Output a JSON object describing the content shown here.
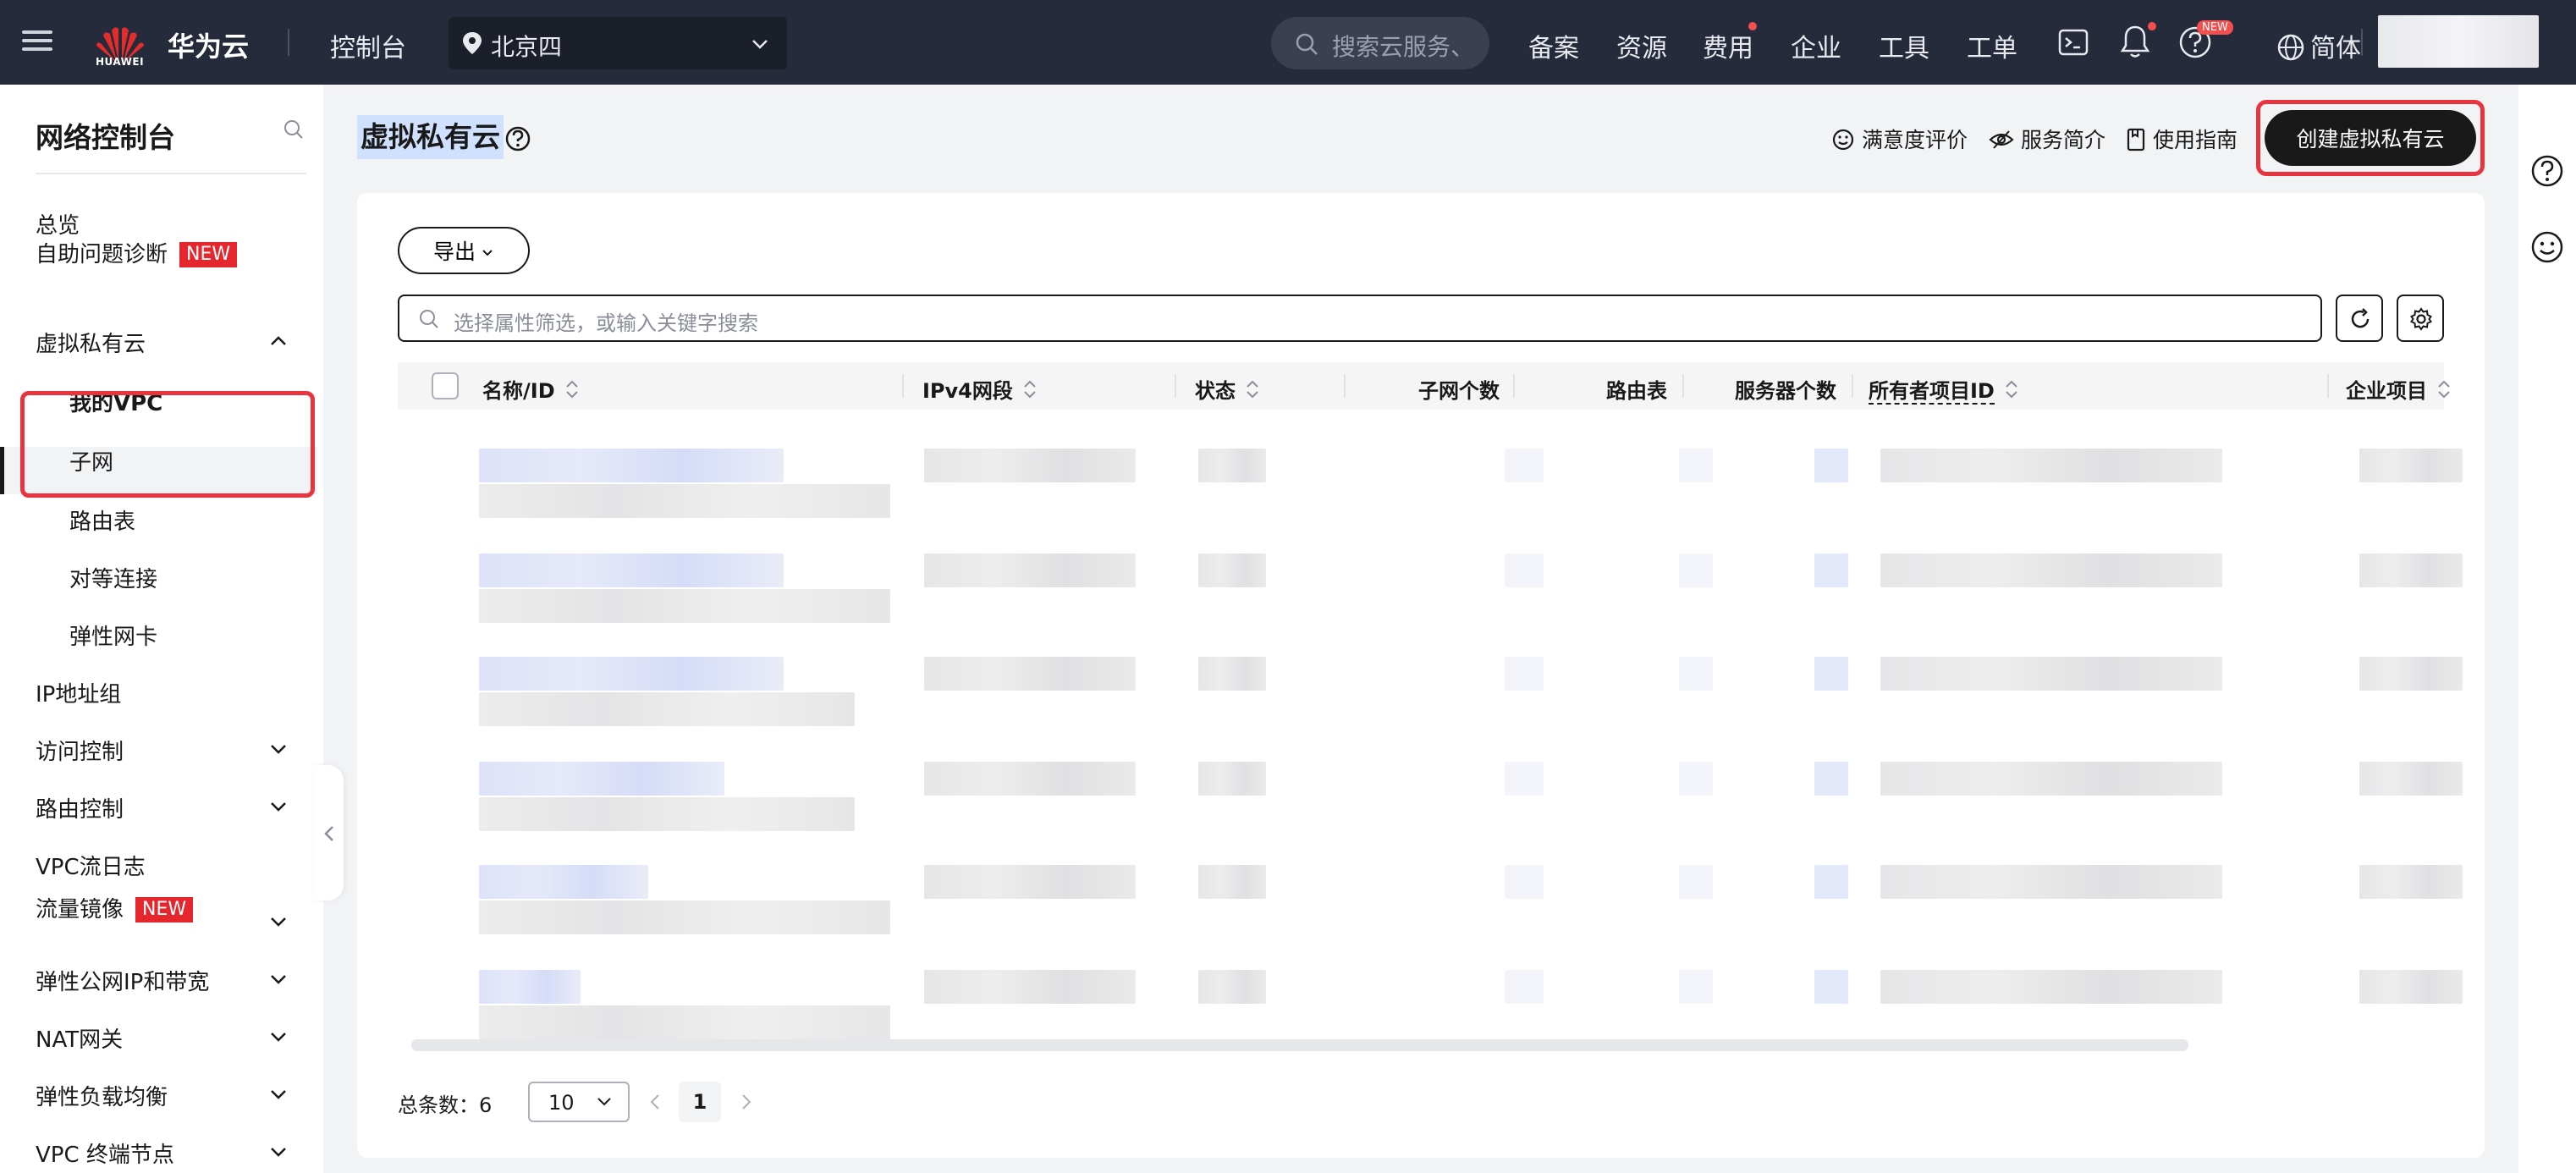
{
  "topbar": {
    "logo_text": "HUAWEI",
    "brand": "华为云",
    "console": "控制台",
    "region": "北京四",
    "search_placeholder": "搜索云服务、",
    "nav": [
      "备案",
      "资源",
      "费用",
      "企业",
      "工具",
      "工单"
    ],
    "new_badge": "NEW",
    "language": "简体"
  },
  "sidebar": {
    "title": "网络控制台",
    "items": [
      {
        "label": "总览"
      },
      {
        "label": "自助问题诊断",
        "badge": "NEW"
      },
      {
        "label": "虚拟私有云"
      },
      {
        "label": "我的VPC"
      },
      {
        "label": "子网"
      },
      {
        "label": "路由表"
      },
      {
        "label": "对等连接"
      },
      {
        "label": "弹性网卡"
      },
      {
        "label": "IP地址组"
      },
      {
        "label": "访问控制"
      },
      {
        "label": "路由控制"
      },
      {
        "label": "VPC流日志"
      },
      {
        "label": "流量镜像",
        "badge": "NEW"
      },
      {
        "label": "弹性公网IP和带宽"
      },
      {
        "label": "NAT网关"
      },
      {
        "label": "弹性负载均衡"
      },
      {
        "label": "VPC 终端节点"
      }
    ]
  },
  "header": {
    "title": "虚拟私有云",
    "links": [
      "满意度评价",
      "服务简介",
      "使用指南"
    ],
    "create_button": "创建虚拟私有云"
  },
  "toolbar": {
    "export_label": "导出",
    "filter_placeholder": "选择属性筛选，或输入关键字搜索"
  },
  "table": {
    "columns": [
      "名称/ID",
      "IPv4网段",
      "状态",
      "子网个数",
      "路由表",
      "服务器个数",
      "所有者项目ID",
      "企业项目"
    ]
  },
  "pagination": {
    "total_label": "总条数：",
    "total": "6",
    "page_size": "10",
    "current_page": "1"
  },
  "colors": {
    "topbar": "#252b3a",
    "highlight": "#e8343f",
    "new_badge": "#e5262c",
    "primary_button": "#191919"
  }
}
